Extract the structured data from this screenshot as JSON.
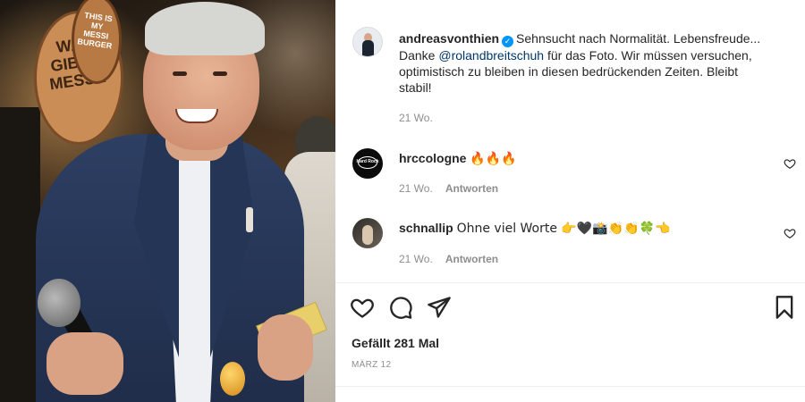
{
  "post": {
    "owner": "andreasvonthien",
    "caption_lead": "Sehnsucht nach Normalität. Lebensfreude...",
    "caption_line2_prefix": "Danke ",
    "mention": "@rolandbreitschuh",
    "caption_line2_suffix": " für das Foto. Wir müssen versuchen,",
    "caption_line3": "optimistisch zu bleiben in diesen bedrückenden Zeiten. Bleibt",
    "caption_line4": "stabil!",
    "age": "21 Wo."
  },
  "photo": {
    "sign_text": "WAS GIBT'S MESSI?",
    "sign_small_text": "THIS IS MY MESSI BURGER"
  },
  "comments": [
    {
      "user": "hrccologne",
      "text": "🔥🔥🔥",
      "age": "21 Wo.",
      "reply_label": "Antworten",
      "avatar_text": "Hard Rock"
    },
    {
      "user": "schnallip",
      "text": "Ohne viel Worte 👉🖤📸👏👏🍀👈",
      "age": "21 Wo.",
      "reply_label": "Antworten"
    }
  ],
  "footer": {
    "likes": "Gefällt 281 Mal",
    "date": "MÄRZ 12"
  },
  "colors": {
    "verified_blue": "#0095f6",
    "mention_blue": "#00376b",
    "muted_gray": "#8e8e8e"
  },
  "icons": [
    "heart-icon",
    "comment-icon",
    "share-icon",
    "bookmark-icon",
    "verified-badge-icon"
  ]
}
